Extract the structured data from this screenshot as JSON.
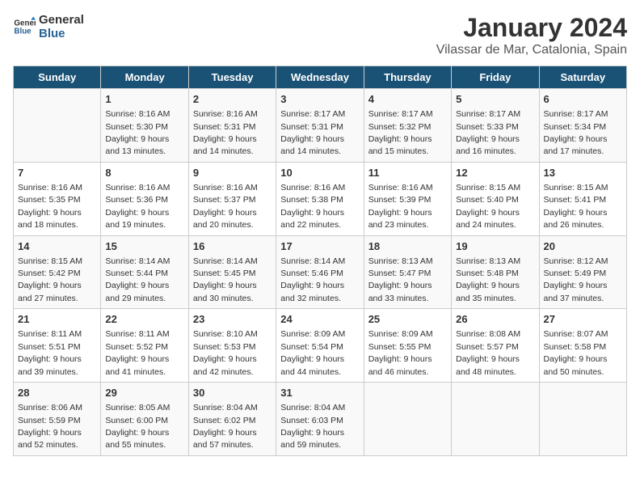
{
  "header": {
    "logo_line1": "General",
    "logo_line2": "Blue",
    "main_title": "January 2024",
    "subtitle": "Vilassar de Mar, Catalonia, Spain"
  },
  "days_of_week": [
    "Sunday",
    "Monday",
    "Tuesday",
    "Wednesday",
    "Thursday",
    "Friday",
    "Saturday"
  ],
  "weeks": [
    [
      {
        "day": "",
        "info": ""
      },
      {
        "day": "1",
        "info": "Sunrise: 8:16 AM\nSunset: 5:30 PM\nDaylight: 9 hours\nand 13 minutes."
      },
      {
        "day": "2",
        "info": "Sunrise: 8:16 AM\nSunset: 5:31 PM\nDaylight: 9 hours\nand 14 minutes."
      },
      {
        "day": "3",
        "info": "Sunrise: 8:17 AM\nSunset: 5:31 PM\nDaylight: 9 hours\nand 14 minutes."
      },
      {
        "day": "4",
        "info": "Sunrise: 8:17 AM\nSunset: 5:32 PM\nDaylight: 9 hours\nand 15 minutes."
      },
      {
        "day": "5",
        "info": "Sunrise: 8:17 AM\nSunset: 5:33 PM\nDaylight: 9 hours\nand 16 minutes."
      },
      {
        "day": "6",
        "info": "Sunrise: 8:17 AM\nSunset: 5:34 PM\nDaylight: 9 hours\nand 17 minutes."
      }
    ],
    [
      {
        "day": "7",
        "info": "Sunrise: 8:16 AM\nSunset: 5:35 PM\nDaylight: 9 hours\nand 18 minutes."
      },
      {
        "day": "8",
        "info": "Sunrise: 8:16 AM\nSunset: 5:36 PM\nDaylight: 9 hours\nand 19 minutes."
      },
      {
        "day": "9",
        "info": "Sunrise: 8:16 AM\nSunset: 5:37 PM\nDaylight: 9 hours\nand 20 minutes."
      },
      {
        "day": "10",
        "info": "Sunrise: 8:16 AM\nSunset: 5:38 PM\nDaylight: 9 hours\nand 22 minutes."
      },
      {
        "day": "11",
        "info": "Sunrise: 8:16 AM\nSunset: 5:39 PM\nDaylight: 9 hours\nand 23 minutes."
      },
      {
        "day": "12",
        "info": "Sunrise: 8:15 AM\nSunset: 5:40 PM\nDaylight: 9 hours\nand 24 minutes."
      },
      {
        "day": "13",
        "info": "Sunrise: 8:15 AM\nSunset: 5:41 PM\nDaylight: 9 hours\nand 26 minutes."
      }
    ],
    [
      {
        "day": "14",
        "info": "Sunrise: 8:15 AM\nSunset: 5:42 PM\nDaylight: 9 hours\nand 27 minutes."
      },
      {
        "day": "15",
        "info": "Sunrise: 8:14 AM\nSunset: 5:44 PM\nDaylight: 9 hours\nand 29 minutes."
      },
      {
        "day": "16",
        "info": "Sunrise: 8:14 AM\nSunset: 5:45 PM\nDaylight: 9 hours\nand 30 minutes."
      },
      {
        "day": "17",
        "info": "Sunrise: 8:14 AM\nSunset: 5:46 PM\nDaylight: 9 hours\nand 32 minutes."
      },
      {
        "day": "18",
        "info": "Sunrise: 8:13 AM\nSunset: 5:47 PM\nDaylight: 9 hours\nand 33 minutes."
      },
      {
        "day": "19",
        "info": "Sunrise: 8:13 AM\nSunset: 5:48 PM\nDaylight: 9 hours\nand 35 minutes."
      },
      {
        "day": "20",
        "info": "Sunrise: 8:12 AM\nSunset: 5:49 PM\nDaylight: 9 hours\nand 37 minutes."
      }
    ],
    [
      {
        "day": "21",
        "info": "Sunrise: 8:11 AM\nSunset: 5:51 PM\nDaylight: 9 hours\nand 39 minutes."
      },
      {
        "day": "22",
        "info": "Sunrise: 8:11 AM\nSunset: 5:52 PM\nDaylight: 9 hours\nand 41 minutes."
      },
      {
        "day": "23",
        "info": "Sunrise: 8:10 AM\nSunset: 5:53 PM\nDaylight: 9 hours\nand 42 minutes."
      },
      {
        "day": "24",
        "info": "Sunrise: 8:09 AM\nSunset: 5:54 PM\nDaylight: 9 hours\nand 44 minutes."
      },
      {
        "day": "25",
        "info": "Sunrise: 8:09 AM\nSunset: 5:55 PM\nDaylight: 9 hours\nand 46 minutes."
      },
      {
        "day": "26",
        "info": "Sunrise: 8:08 AM\nSunset: 5:57 PM\nDaylight: 9 hours\nand 48 minutes."
      },
      {
        "day": "27",
        "info": "Sunrise: 8:07 AM\nSunset: 5:58 PM\nDaylight: 9 hours\nand 50 minutes."
      }
    ],
    [
      {
        "day": "28",
        "info": "Sunrise: 8:06 AM\nSunset: 5:59 PM\nDaylight: 9 hours\nand 52 minutes."
      },
      {
        "day": "29",
        "info": "Sunrise: 8:05 AM\nSunset: 6:00 PM\nDaylight: 9 hours\nand 55 minutes."
      },
      {
        "day": "30",
        "info": "Sunrise: 8:04 AM\nSunset: 6:02 PM\nDaylight: 9 hours\nand 57 minutes."
      },
      {
        "day": "31",
        "info": "Sunrise: 8:04 AM\nSunset: 6:03 PM\nDaylight: 9 hours\nand 59 minutes."
      },
      {
        "day": "",
        "info": ""
      },
      {
        "day": "",
        "info": ""
      },
      {
        "day": "",
        "info": ""
      }
    ]
  ]
}
